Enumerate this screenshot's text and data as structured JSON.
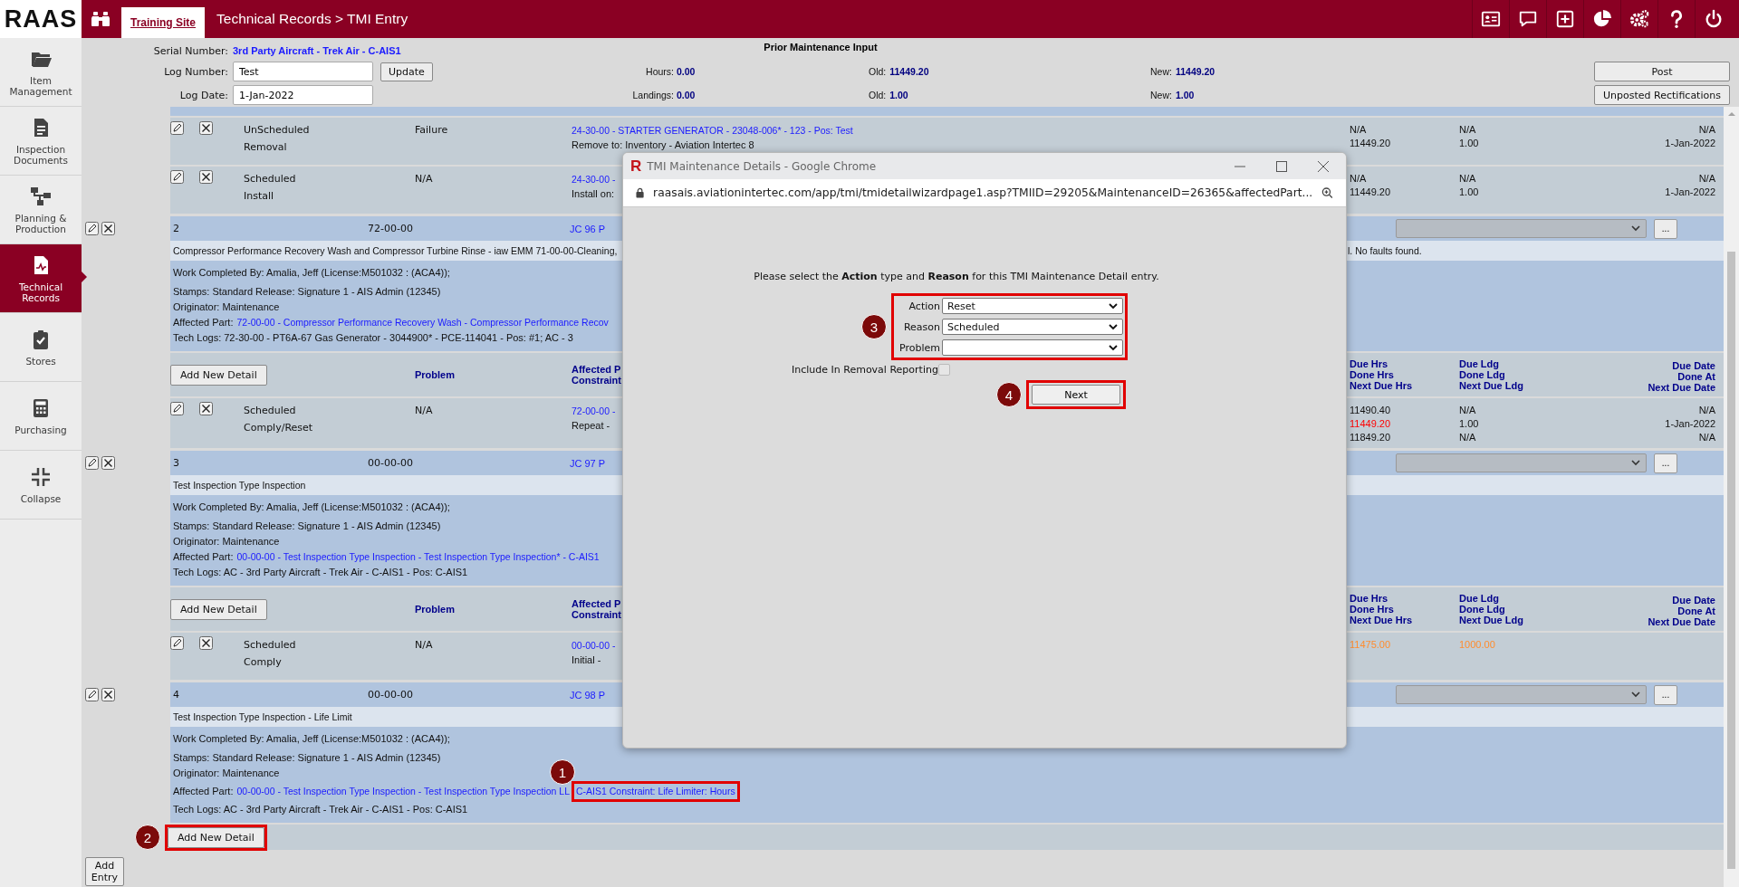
{
  "app": {
    "logo": "RAAS",
    "site_tab": "Training Site",
    "breadcrumb": "Technical Records > TMI Entry"
  },
  "sidebar": {
    "items": [
      {
        "label": "Item Management",
        "selected": false
      },
      {
        "label": "Inspection Documents",
        "selected": false
      },
      {
        "label": "Planning & Production",
        "selected": false
      },
      {
        "label": "Technical Records",
        "selected": true
      },
      {
        "label": "Stores",
        "selected": false
      },
      {
        "label": "Purchasing",
        "selected": false
      },
      {
        "label": "Collapse",
        "selected": false
      }
    ]
  },
  "form": {
    "serial_label": "Serial Number:",
    "serial_value": "3rd Party Aircraft - Trek Air - C-AIS1",
    "log_number_label": "Log Number:",
    "log_number": "Test",
    "update_button": "Update",
    "log_date_label": "Log Date:",
    "log_date": "1-Jan-2022"
  },
  "prior_maintenance": {
    "title": "Prior Maintenance Input",
    "rows": [
      {
        "label": "Hours:",
        "value": "0.00",
        "old_label": "Old:",
        "old": "11449.20",
        "new_label": "New:",
        "new": "11449.20"
      },
      {
        "label": "Landings:",
        "value": "0.00",
        "old_label": "Old:",
        "old": "1.00",
        "new_label": "New:",
        "new": "1.00"
      }
    ]
  },
  "actions": [
    "Post",
    "Unposted Rectifications"
  ],
  "entries": [
    {
      "details": [
        {
          "type": "UnScheduled",
          "action": "Removal",
          "problem": "Failure",
          "part_link": "24-30-00 - STARTER GENERATOR - 23048-006* - 123 - Pos: Test",
          "part_note": "Remove to: Inventory - Aviation Intertec 8",
          "hours": [
            {
              "text": "N/A"
            },
            {
              "text": "11449.20"
            }
          ],
          "landings": [
            {
              "text": "N/A"
            },
            {
              "text": "1.00"
            }
          ],
          "dates": [
            {
              "text": "N/A"
            },
            {
              "text": "1-Jan-2022"
            }
          ]
        },
        {
          "type": "Scheduled",
          "action": "Install",
          "problem": "N/A",
          "part_link": "24-30-00 -",
          "part_note": "Install on:",
          "hours": [
            {
              "text": "N/A"
            },
            {
              "text": "11449.20"
            }
          ],
          "landings": [
            {
              "text": "N/A"
            },
            {
              "text": "1.00"
            }
          ],
          "dates": [
            {
              "text": "N/A"
            },
            {
              "text": "1-Jan-2022"
            }
          ]
        }
      ]
    },
    {
      "number": "2",
      "code": "72-00-00",
      "job_card": "JC 96 P",
      "more_button": "...",
      "description": "Compressor Performance Recovery Wash and Compressor Turbine Rinse - iaw EMM 71-00-00-Cleaning,",
      "description_tail": "l. No faults found.",
      "work": {
        "completed_by": "Work Completed By: Amalia, Jeff (License:M501032 : (ACA4));",
        "stamps": "Stamps: Standard Release: Signature 1 - AIS Admin (12345)",
        "originator": "Originator: Maintenance",
        "affected_label": "Affected Part:",
        "affected_links": [
          {
            "text": "72-00-00 - Compressor Performance Recovery Wash - Compressor Performance Recov"
          }
        ],
        "tech_logs": "Tech Logs: 72-30-00 - PT6A-67 Gas Generator - 3044900* - PCE-114041 - Pos: #1; AC - 3"
      },
      "detail_header": {
        "button": "Add New Detail",
        "problem": "Problem",
        "part": [
          "Affected P",
          "Constraint"
        ],
        "hours": [
          "Due Hrs",
          "Done Hrs",
          "Next Due Hrs"
        ],
        "landings": [
          "Due Ldg",
          "Done Ldg",
          "Next Due Ldg"
        ],
        "dates": [
          "Due Date",
          "Done At",
          "Next Due Date"
        ]
      },
      "details": [
        {
          "type": "Scheduled",
          "action": "Comply/Reset",
          "problem": "N/A",
          "part_link": "72-00-00 -",
          "part_note": "Repeat -",
          "hours": [
            {
              "text": "11490.40"
            },
            {
              "text": "11449.20",
              "color": "#ff0000"
            },
            {
              "text": "11849.20"
            }
          ],
          "landings": [
            {
              "text": "N/A"
            },
            {
              "text": "1.00"
            },
            {
              "text": "N/A"
            }
          ],
          "dates": [
            {
              "text": "N/A"
            },
            {
              "text": "1-Jan-2022"
            },
            {
              "text": "N/A"
            }
          ]
        }
      ]
    },
    {
      "number": "3",
      "code": "00-00-00",
      "job_card": "JC 97 P",
      "more_button": "...",
      "description": "Test Inspection Type Inspection",
      "work": {
        "completed_by": "Work Completed By: Amalia, Jeff (License:M501032 : (ACA4));",
        "stamps": "Stamps: Standard Release: Signature 1 - AIS Admin (12345)",
        "originator": "Originator: Maintenance",
        "affected_label": "Affected Part:",
        "affected_links": [
          {
            "text": "00-00-00 - Test Inspection Type Inspection - Test Inspection Type Inspection* - C-AIS1"
          }
        ],
        "tech_logs": "Tech Logs: AC - 3rd Party Aircraft - Trek Air - C-AIS1 - Pos: C-AIS1"
      },
      "detail_header": {
        "button": "Add New Detail",
        "problem": "Problem",
        "part": [
          "Affected P",
          "Constraint"
        ],
        "hours": [
          "Due Hrs",
          "Done Hrs",
          "Next Due Hrs"
        ],
        "landings": [
          "Due Ldg",
          "Done Ldg",
          "Next Due Ldg"
        ],
        "dates": [
          "Due Date",
          "Done At",
          "Next Due Date"
        ]
      },
      "details": [
        {
          "type": "Scheduled",
          "action": "Comply",
          "problem": "N/A",
          "part_link": "00-00-00 -",
          "part_note": "Initial -",
          "hours": [
            {
              "text": "11475.00",
              "color": "#ff8c2e"
            }
          ],
          "landings": [
            {
              "text": "1000.00",
              "color": "#ff8c2e"
            }
          ]
        }
      ]
    },
    {
      "number": "4",
      "code": "00-00-00",
      "job_card": "JC 98 P",
      "more_button": "...",
      "description": "Test Inspection Type Inspection - Life Limit",
      "work": {
        "completed_by": "Work Completed By: Amalia, Jeff (License:M501032 : (ACA4));",
        "stamps": "Stamps: Standard Release: Signature 1 - AIS Admin (12345)",
        "originator": "Originator: Maintenance",
        "affected_label": "Affected Part:",
        "affected_links": [
          {
            "text": "00-00-00 - Test Inspection Type Inspection - Test Inspection Type Inspection LL"
          },
          {
            "text": "C-AIS1 Constraint: Life Limiter: Hours",
            "callout": "1"
          }
        ],
        "tech_logs": "Tech Logs: AC - 3rd Party Aircraft - Trek Air - C-AIS1 - Pos: C-AIS1"
      },
      "add_button": {
        "label": "Add New Detail",
        "callout": "2"
      }
    }
  ],
  "add_entry": "Add Entry",
  "popup": {
    "app_mark": "R",
    "title": "TMI Maintenance Details - Google Chrome",
    "url": "raasais.aviationintertec.com/app/tmi/tmidetailwizardpage1.asp?TMIID=29205&MaintenanceID=26365&affectedPart...",
    "prompt": "Please select the **Action** type and **Reason** for this TMI Maintenance Detail entry.",
    "fields": [
      {
        "label": "Action",
        "value": "Reset"
      },
      {
        "label": "Reason",
        "value": "Scheduled"
      },
      {
        "label": "Problem"
      }
    ],
    "fields_callout": "3",
    "checkbox": {
      "label": "Include In Removal Reporting",
      "checked": false
    },
    "next_button": {
      "label": "Next",
      "callout": "4"
    }
  }
}
